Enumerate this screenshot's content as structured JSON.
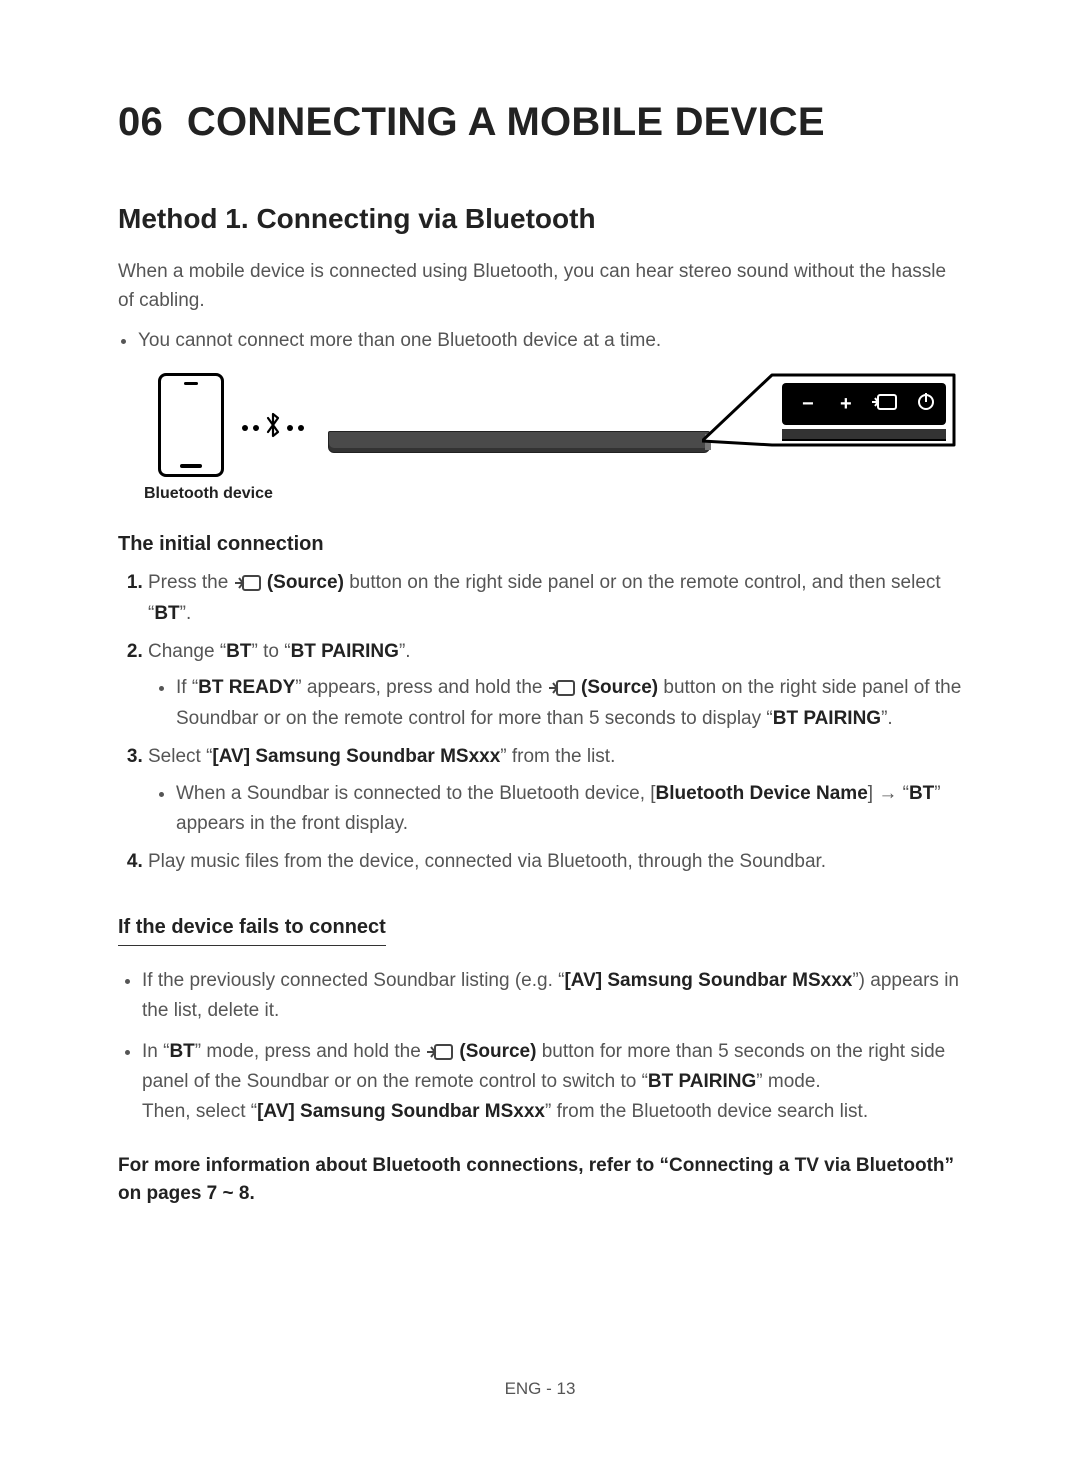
{
  "chapter": {
    "number": "06",
    "title": "CONNECTING A MOBILE DEVICE"
  },
  "section1": {
    "heading": "Method 1. Connecting via Bluetooth",
    "lead": "When a mobile device is connected using Bluetooth, you can hear stereo sound without the hassle of cabling.",
    "note": "You cannot connect more than one Bluetooth device at a time.",
    "diagram_caption": "Bluetooth device"
  },
  "initial": {
    "heading": "The initial connection",
    "step1_pre": "Press the ",
    "source_label": "(Source)",
    "step1_post": " button on the right side panel or on the remote control, and then select “",
    "bt": "BT",
    "closeq": "”.",
    "step2_pre": "Change “",
    "step2_mid": "” to “",
    "bt_pairing": "BT PAIRING",
    "step2_sub_pre": "If “",
    "bt_ready": "BT READY",
    "step2_sub_mid": "” appears, press and hold the ",
    "step2_sub_post": " button on the right side panel of the Soundbar or on the remote control for more than 5 seconds to display “",
    "step3_pre": "Select “",
    "av_name": "[AV] Samsung Soundbar MSxxx",
    "step3_post": "” from the list.",
    "step3_sub_pre": "When a Soundbar is connected to the Bluetooth device, [",
    "bt_dev_name": "Bluetooth Device Name",
    "step3_sub_mid": "] → “",
    "step3_sub_post": "” appears in the front display.",
    "step4": "Play music files from the device, connected via Bluetooth, through the Soundbar."
  },
  "fails": {
    "heading": "If the device fails to connect",
    "b1_pre": "If the previously connected Soundbar listing (e.g. “",
    "b1_post": "”) appears in the list, delete it.",
    "b2_pre": "In “",
    "b2_mid": "” mode, press and hold the ",
    "b2_post": " button for more than 5 seconds on the right side panel of the Soundbar or on the remote control to switch to “",
    "b2_end": "” mode.",
    "b2_line2_pre": "Then, select “",
    "b2_line2_post": "” from the Bluetooth device search list."
  },
  "info": "For more information about Bluetooth connections, refer to “Connecting a TV via Bluetooth” on pages 7 ~ 8.",
  "footer": "ENG - 13",
  "icons": {
    "source": "source-icon",
    "minus": "−",
    "plus": "+",
    "power": "⏻"
  }
}
